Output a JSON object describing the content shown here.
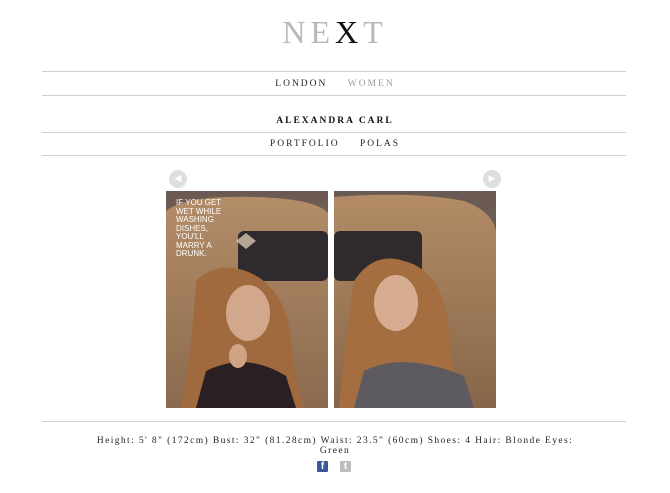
{
  "brand": {
    "logo_part1": "NE",
    "logo_part2": "X",
    "logo_part3": "T"
  },
  "nav": {
    "city": "LONDON",
    "division": "WOMEN"
  },
  "model": {
    "name": "ALEXANDRA CARL"
  },
  "subnav": {
    "portfolio": "PORTFOLIO",
    "polas": "POLAS"
  },
  "gallery": {
    "prev_icon": "chevron-left-icon",
    "next_icon": "chevron-right-icon",
    "left_caption": "IF YOU GET WET WHILE WASHING DISHES, YOU'LL MARRY A DRUNK.",
    "left_caption_lines": [
      "IF YOU GET",
      "WET WHILE",
      "WASHING",
      "DISHES,",
      "YOU'LL",
      "MARRY A",
      "DRUNK."
    ]
  },
  "stats": {
    "line1": "Height: 5' 8\" (172cm) Bust: 32\" (81.28cm) Waist: 23.5\" (60cm) Shoes: 4 Hair: Blonde Eyes:",
    "line2": "Green"
  },
  "social": {
    "facebook_icon": "facebook-icon",
    "twitter_icon": "twitter-icon"
  }
}
